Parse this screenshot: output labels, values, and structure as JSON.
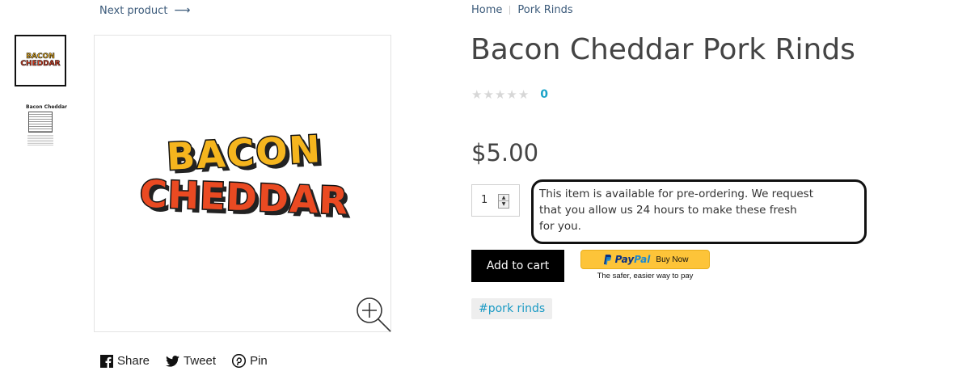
{
  "nav": {
    "next_product": "Next product"
  },
  "breadcrumb": {
    "items": [
      "Home",
      "Pork Rinds"
    ]
  },
  "gallery": {
    "thumb_logo_line1": "BACON",
    "thumb_logo_line2": "CHEDDAR",
    "thumb_label_title": "Bacon Cheddar",
    "main_logo_line1": "BACON",
    "main_logo_line2": "CHEDDAR"
  },
  "product": {
    "title": "Bacon Cheddar Pork Rinds",
    "rating_count": "0",
    "price": "$5.00",
    "quantity": "1",
    "preorder_note": "This item is available for pre-ordering. We request that you allow us 24 hours to make these fresh for you.",
    "tag": "#pork rinds"
  },
  "actions": {
    "add_to_cart": "Add to cart",
    "paypal_pay": "Pay",
    "paypal_pal": "Pal",
    "paypal_buy": "Buy Now",
    "paypal_tagline": "The safer, easier way to pay"
  },
  "share": {
    "share": "Share",
    "tweet": "Tweet",
    "pin": "Pin"
  },
  "colors": {
    "accent_link": "#3b5a7a",
    "rating_count": "#1aa3c8",
    "paypal_yellow": "#fdc439",
    "button": "#000000"
  }
}
